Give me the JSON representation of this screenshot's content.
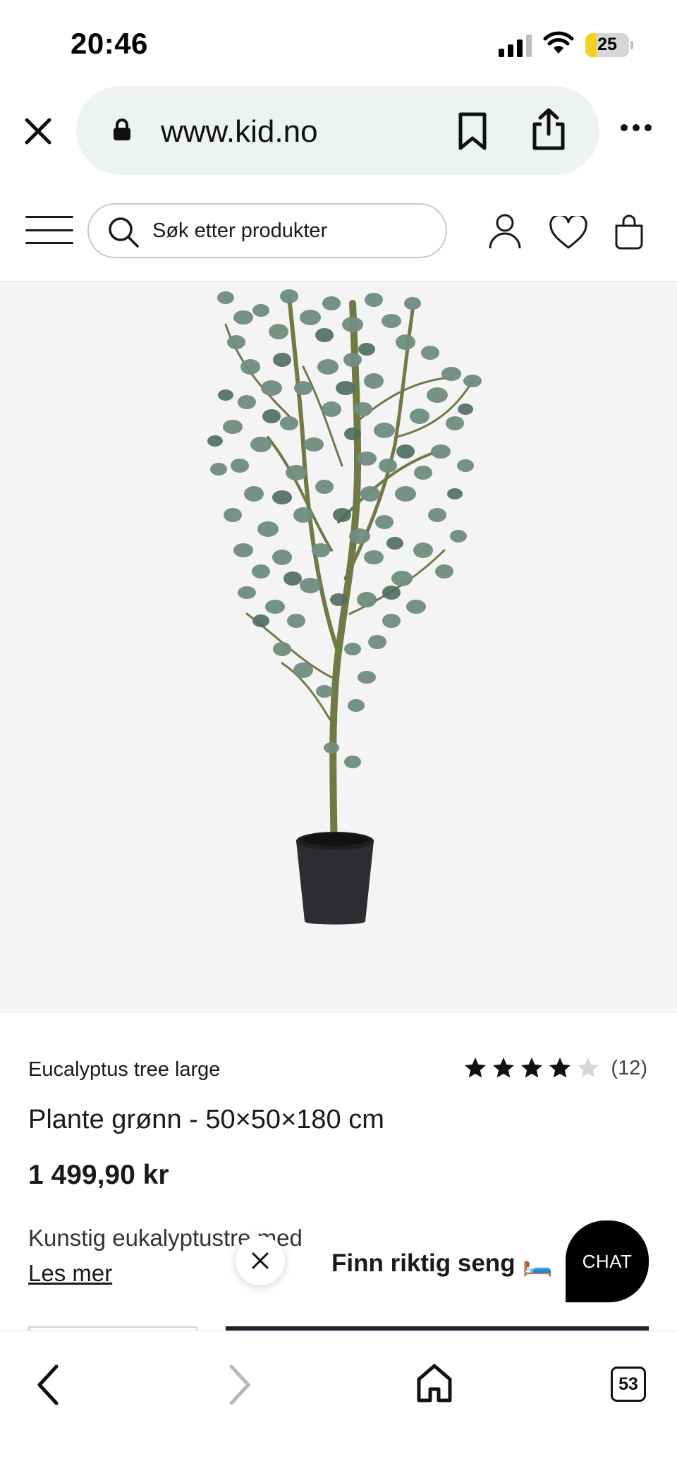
{
  "status_bar": {
    "time": "20:46",
    "battery_level": "25",
    "icons": [
      "signal-icon",
      "wifi-icon",
      "battery-icon"
    ]
  },
  "browser": {
    "url": "www.kid.no",
    "tab_count": "53",
    "icons": [
      "close-icon",
      "lock-icon",
      "bookmark-icon",
      "share-icon",
      "more-icon",
      "back-icon",
      "forward-icon",
      "home-icon",
      "tabs-icon"
    ]
  },
  "header": {
    "search_placeholder": "Søk etter produkter",
    "icons": [
      "menu-icon",
      "search-icon",
      "account-icon",
      "heart-icon",
      "bag-icon"
    ]
  },
  "product": {
    "brand": "Eucalyptus tree large",
    "title": "Plante grønn - 50×50×180 cm",
    "price": "1 499,90 kr",
    "description": "Kunstig eukalyptustre med",
    "read_more": "Les mer",
    "rating_stars": 4,
    "rating_max": 5,
    "rating_count": "(12)"
  },
  "promo": {
    "text": "Finn riktig seng",
    "emoji": "🛏️"
  },
  "chat": {
    "label": "CHAT"
  },
  "colors": {
    "image_background": "#f4f4f4",
    "url_pill": "#eff2f3",
    "battery_fill": "#f5d020",
    "primary_dark": "#1f1f2e",
    "leaf": "#6f8d80",
    "leaf_dark": "#4e6d60",
    "trunk": "#6f7a45",
    "pot": "#2b2d30"
  }
}
